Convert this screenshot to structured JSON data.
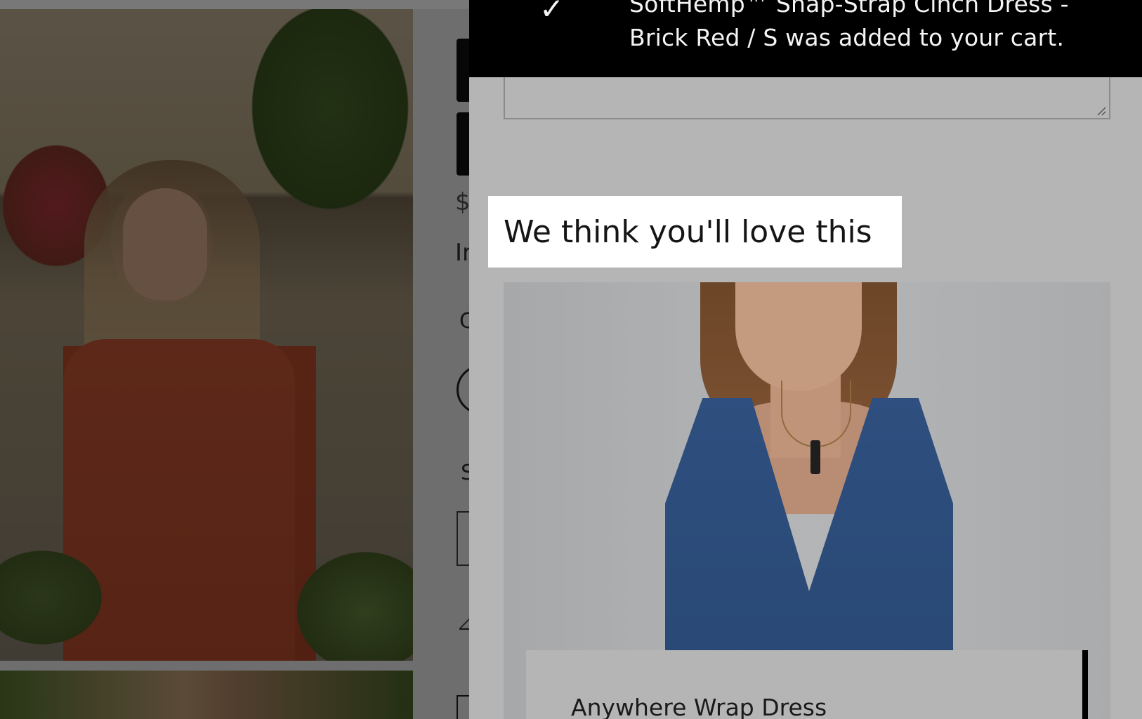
{
  "toast": {
    "message": "SoftHemp™ Snap-Strap Cinch Dress - Brick Red / S was added to your cart.",
    "icon": "check-icon"
  },
  "cart": {
    "recommendation_heading": "We think you'll love this",
    "recommended_product": {
      "name": "Anywhere Wrap Dress"
    }
  },
  "product_page": {
    "price_glyph": "$",
    "info_glyph": "Ir",
    "color_glyph": "C",
    "size_glyph": "S",
    "ruler_glyph": "⊿"
  },
  "colors": {
    "toast_bg": "#000000",
    "drawer_bg": "#b5b5b5",
    "dress_red": "#c04f2f",
    "dress_blue": "#2e4f7f"
  }
}
